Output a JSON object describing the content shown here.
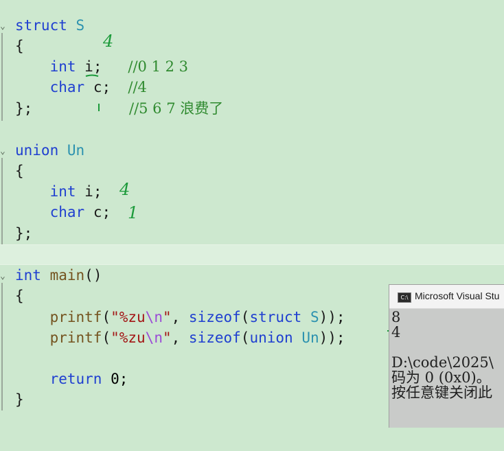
{
  "editor": {
    "struct_keyword": "struct",
    "struct_name": "S",
    "open_brace": "{",
    "close_brace_semi": "};",
    "close_brace": "}",
    "int_kw": "int",
    "char_kw": "char",
    "member_i": "i;",
    "member_c": "c;",
    "comment_i": "//0 1 2 3",
    "comment_c": "//4",
    "comment_pad": "//5 6 7 浪费了",
    "union_keyword": "union",
    "union_name": "Un",
    "main_name": "main",
    "main_parens": "()",
    "printf1": {
      "fn": "printf",
      "open": "(",
      "str_start": "\"%zu",
      "esc": "\\n",
      "str_end": "\"",
      "comma": ", ",
      "sizeof": "sizeof",
      "paren_open": "(",
      "kw": "struct",
      "type": "S",
      "close": "));"
    },
    "printf2": {
      "fn": "printf",
      "open": "(",
      "str_start": "\"%zu",
      "esc": "\\n",
      "str_end": "\"",
      "comma": ", ",
      "sizeof": "sizeof",
      "paren_open": "(",
      "kw": "union",
      "type": "Un",
      "close": "));"
    },
    "return_kw": "return",
    "return_val": "0;"
  },
  "annotations": {
    "struct_mark": "4",
    "union_int_mark": "4",
    "union_char_mark": "1"
  },
  "console": {
    "title": "Microsoft Visual Stu",
    "icon_label": "C:\\",
    "output": "8\n4\n\nD:\\code\\2025\\\n码为 0 (0x0)。\n按任意键关闭此"
  },
  "colors": {
    "background": "#cde8cf",
    "keyword": "#1f3fd0",
    "type": "#2b91af",
    "function": "#74531f",
    "string": "#a31515",
    "escape": "#9b4bd6",
    "comment": "#2f8a2f",
    "annotation_ink": "#1b9a3a"
  }
}
